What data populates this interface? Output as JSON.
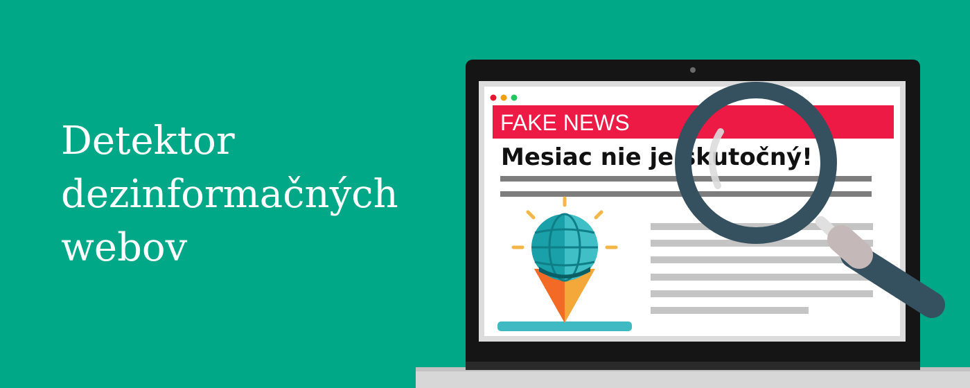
{
  "hero": {
    "title_lines": [
      "Detektor",
      "dezinformačných",
      "webov"
    ]
  },
  "screen": {
    "banner_label": "FAKE NEWS",
    "headline": "Mesiac nie je skutočný!",
    "window_dots": [
      "#e5172f",
      "#f59e0b",
      "#22c55e"
    ]
  },
  "colors": {
    "background": "#00a887",
    "banner": "#ec1a45",
    "magnifier": "#35505e"
  },
  "icons": {
    "magnifier": "magnifying-glass-icon",
    "globe": "globe-icon",
    "cone": "ice-cream-cone-icon"
  }
}
